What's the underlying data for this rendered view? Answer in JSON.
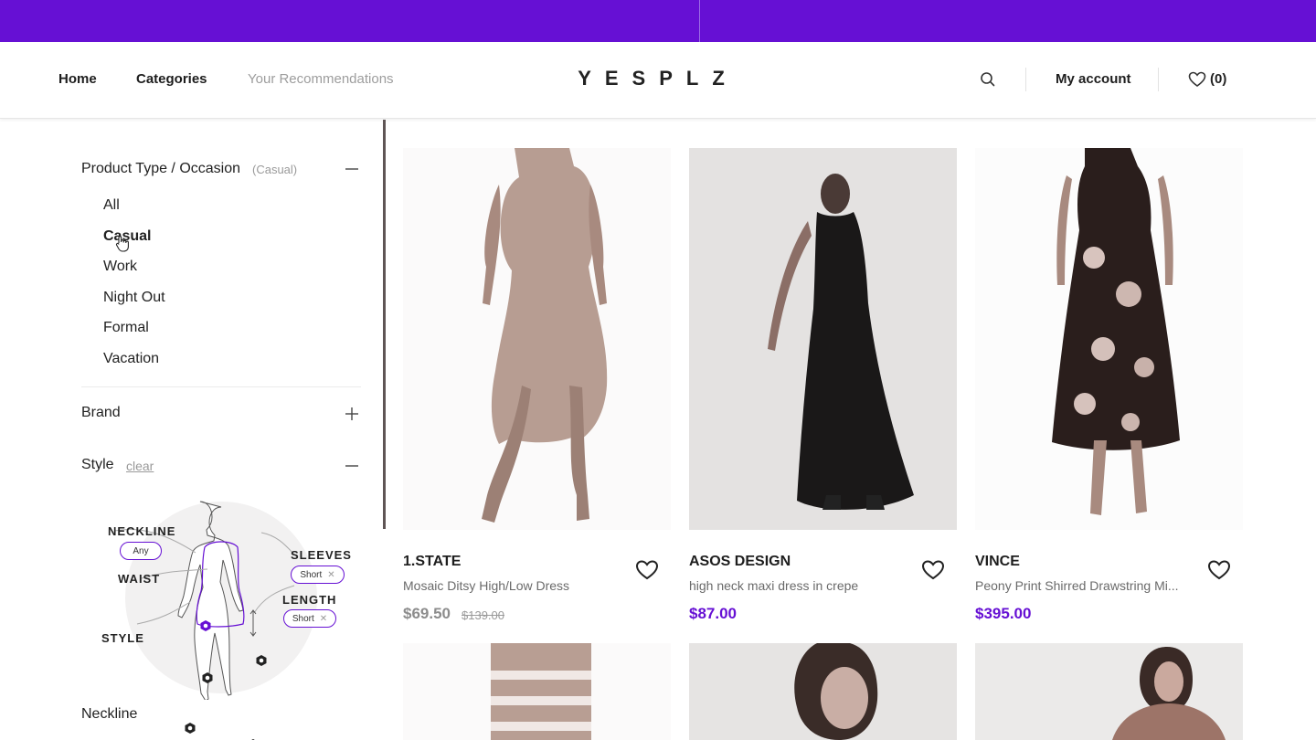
{
  "header": {
    "nav": [
      "Home",
      "Categories",
      "Your Recommendations"
    ],
    "logo": "YESPLZ",
    "account": "My account",
    "wishlist_count": "(0)"
  },
  "sidebar": {
    "product_type": {
      "title": "Product Type / Occasion",
      "selected_note": "(Casual)",
      "options": [
        "All",
        "Casual",
        "Work",
        "Night Out",
        "Formal",
        "Vacation"
      ],
      "active": "Casual"
    },
    "brand": {
      "title": "Brand"
    },
    "style": {
      "title": "Style",
      "clear": "clear",
      "labels": {
        "neckline": "NECKLINE",
        "waist": "WAIST",
        "style": "STYLE",
        "sleeves": "SLEEVES",
        "length": "LENGTH"
      },
      "pills": {
        "neckline": "Any",
        "sleeves": "Short",
        "length": "Short"
      }
    },
    "neckline": {
      "title": "Neckline"
    }
  },
  "products": [
    {
      "brand": "1.STATE",
      "name": "Mosaic Ditsy High/Low Dress",
      "price": "$69.50",
      "old_price": "$139.00"
    },
    {
      "brand": "ASOS DESIGN",
      "name": "high neck maxi dress in crepe",
      "price": "$87.00"
    },
    {
      "brand": "VINCE",
      "name": "Peony Print Shirred Drawstring Mi...",
      "price": "$395.00"
    }
  ],
  "colors": {
    "accent": "#6610d4",
    "sale_price": "#8c8c8c"
  }
}
